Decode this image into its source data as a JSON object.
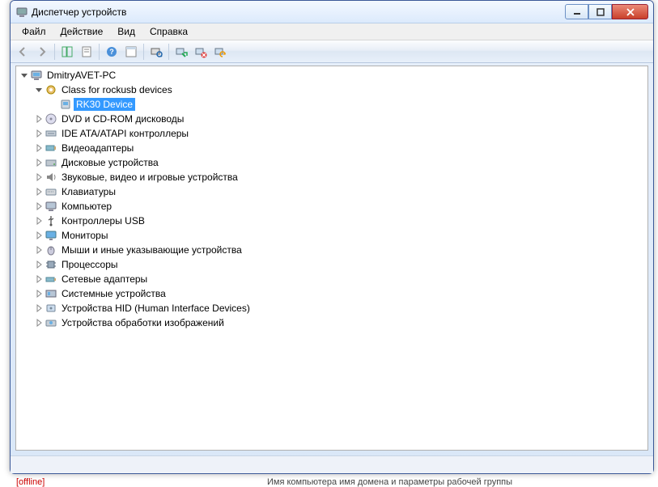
{
  "window": {
    "title": "Диспетчер устройств"
  },
  "menu": {
    "file": "Файл",
    "action": "Действие",
    "view": "Вид",
    "help": "Справка"
  },
  "tree": {
    "root": "DmitryAVET-PC",
    "class_rockusb": "Class for rockusb devices",
    "rk30_device": "RK30 Device",
    "dvd": "DVD и CD-ROM дисководы",
    "ide": "IDE ATA/ATAPI контроллеры",
    "video_adapters": "Видеоадаптеры",
    "disk": "Дисковые устройства",
    "sound": "Звуковые, видео и игровые устройства",
    "keyboards": "Клавиатуры",
    "computer": "Компьютер",
    "usb": "Контроллеры USB",
    "monitors": "Мониторы",
    "mice": "Мыши и иные указывающие устройства",
    "processors": "Процессоры",
    "network": "Сетевые адаптеры",
    "system": "Системные устройства",
    "hid": "Устройства HID (Human Interface Devices)",
    "imaging": "Устройства обработки изображений"
  },
  "background": {
    "offline": "[offline]",
    "bottom_text": "Имя компьютера  имя домена и параметры рабочей группы"
  },
  "status": ""
}
